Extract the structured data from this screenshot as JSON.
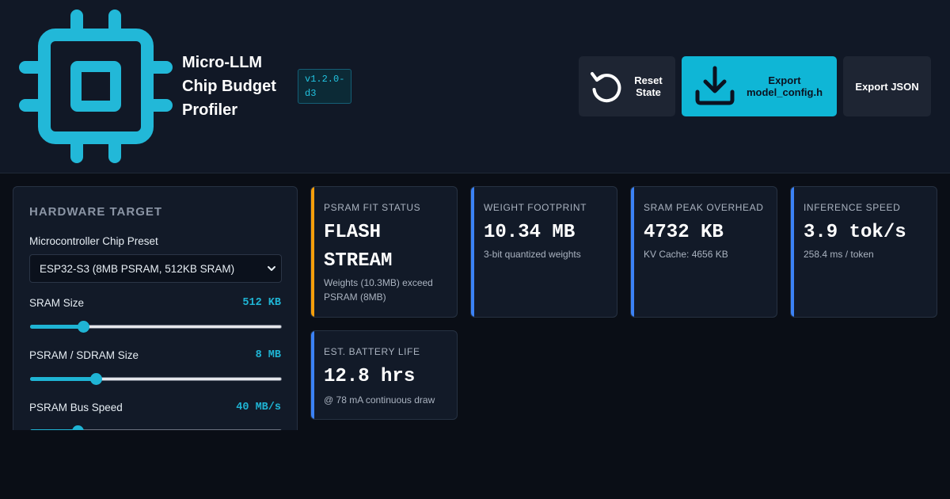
{
  "header": {
    "app_title": "Micro-LLM Chip Budget Profiler",
    "version": "v1.2.0-d3",
    "buttons": {
      "reset_label": "Reset State",
      "export_config_label": "Export model_config.h",
      "export_json_label": "Export JSON"
    },
    "icons": [
      "chip-logo-icon",
      "reset-icon",
      "download-icon"
    ],
    "accent_color": "#0fb6d6"
  },
  "hardware_target": {
    "title": "HARDWARE TARGET",
    "chip_preset": {
      "label": "Microcontroller Chip Preset",
      "selected": "ESP32-S3 (8MB PSRAM, 512KB SRAM)"
    },
    "sram": {
      "label": "SRAM Size",
      "value": "512 KB",
      "slider_fraction": 0.21
    },
    "psram": {
      "label": "PSRAM / SDRAM Size",
      "value": "8 MB",
      "slider_fraction": 0.26
    },
    "psram_bus": {
      "label": "PSRAM Bus Speed",
      "value": "40 MB/s",
      "slider_fraction": 0.19
    }
  },
  "metrics": [
    {
      "label": "PSRAM FIT STATUS",
      "value": "FLASH STREAM",
      "sub": "Weights (10.3MB) exceed PSRAM (8MB)",
      "status_color": "#f59e0b"
    },
    {
      "label": "WEIGHT FOOTPRINT",
      "value": "10.34 MB",
      "sub": "3-bit quantized weights",
      "status_color": "#3b82f6"
    },
    {
      "label": "SRAM PEAK OVERHEAD",
      "value": "4732 KB",
      "sub": "KV Cache: 4656 KB",
      "status_color": "#3b82f6"
    },
    {
      "label": "INFERENCE SPEED",
      "value": "3.9 tok/s",
      "sub": "258.4 ms / token",
      "status_color": "#3b82f6"
    },
    {
      "label": "EST. BATTERY LIFE",
      "value": "12.8 hrs",
      "sub": "@ 78 mA continuous draw",
      "status_color": "#3b82f6"
    }
  ]
}
